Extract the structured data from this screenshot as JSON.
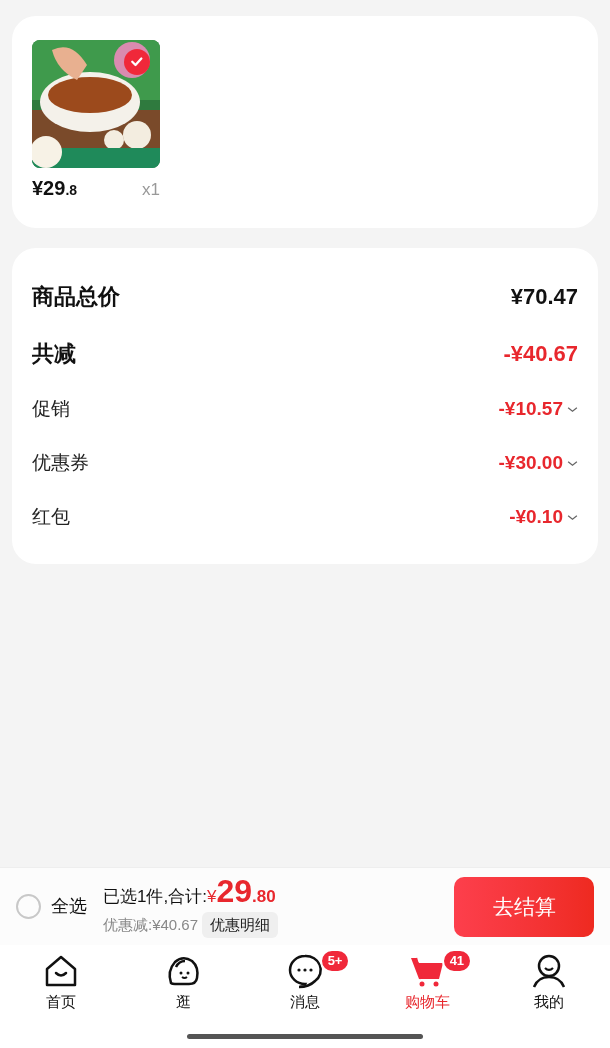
{
  "cart_item": {
    "kind": "picture",
    "selected": true,
    "price_main": "¥29",
    "price_decimal": ".8",
    "quantity": "x1"
  },
  "summary": {
    "rows": [
      {
        "kind": "total",
        "label": "商品总价",
        "value": "¥70.47"
      },
      {
        "kind": "reduction",
        "label": "共减",
        "value": "-¥40.67"
      },
      {
        "kind": "discount",
        "label": "促销",
        "value": "-¥10.57",
        "expanded": false
      },
      {
        "kind": "discount",
        "label": "优惠券",
        "value": "-¥30.00",
        "expanded": false
      },
      {
        "kind": "discount",
        "label": "红包",
        "value": "-¥0.10",
        "expanded": false
      }
    ]
  },
  "checkout_bar": {
    "select_all": {
      "label": "全选",
      "checked": false
    },
    "selected_text": "已选1件,合计:",
    "currency": "¥",
    "total_main": "29",
    "total_decimal": ".80",
    "saving": "优惠减:¥40.67",
    "detail_button": "优惠明细",
    "checkout_button": "去结算"
  },
  "tab_bar": [
    {
      "label": "首页",
      "kind": "home",
      "selected": false
    },
    {
      "label": "逛",
      "kind": "browse",
      "selected": false
    },
    {
      "label": "消息",
      "kind": "chat",
      "selected": false,
      "badge": "5+"
    },
    {
      "label": "购物车",
      "kind": "cart",
      "selected": true,
      "badge": "41"
    },
    {
      "label": "我的",
      "kind": "person",
      "selected": false
    }
  ]
}
